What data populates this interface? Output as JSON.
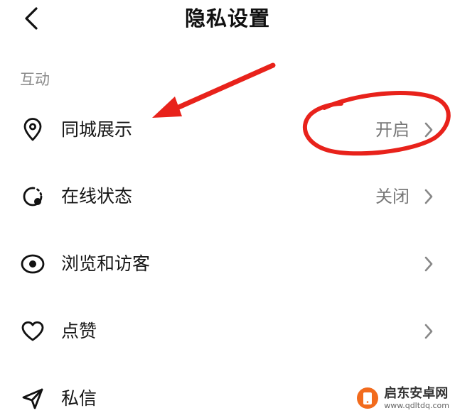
{
  "header": {
    "title": "隐私设置",
    "back_icon": "chevron-left-icon"
  },
  "section": {
    "label": "互动"
  },
  "items": [
    {
      "label": "同城展示",
      "value": "开启",
      "icon": "location-pin-icon"
    },
    {
      "label": "在线状态",
      "value": "关闭",
      "icon": "online-status-icon"
    },
    {
      "label": "浏览和访客",
      "value": "",
      "icon": "eye-icon"
    },
    {
      "label": "点赞",
      "value": "",
      "icon": "heart-icon"
    },
    {
      "label": "私信",
      "value": "",
      "icon": "paper-plane-icon"
    }
  ],
  "annotation": {
    "color": "#e8221b"
  },
  "watermark": {
    "title": "启东安卓网",
    "url": "www.qdltdq.com",
    "color": "#f26b1d"
  },
  "colors": {
    "text": "#151515",
    "secondary": "#777777",
    "section": "#8a8a8a"
  }
}
